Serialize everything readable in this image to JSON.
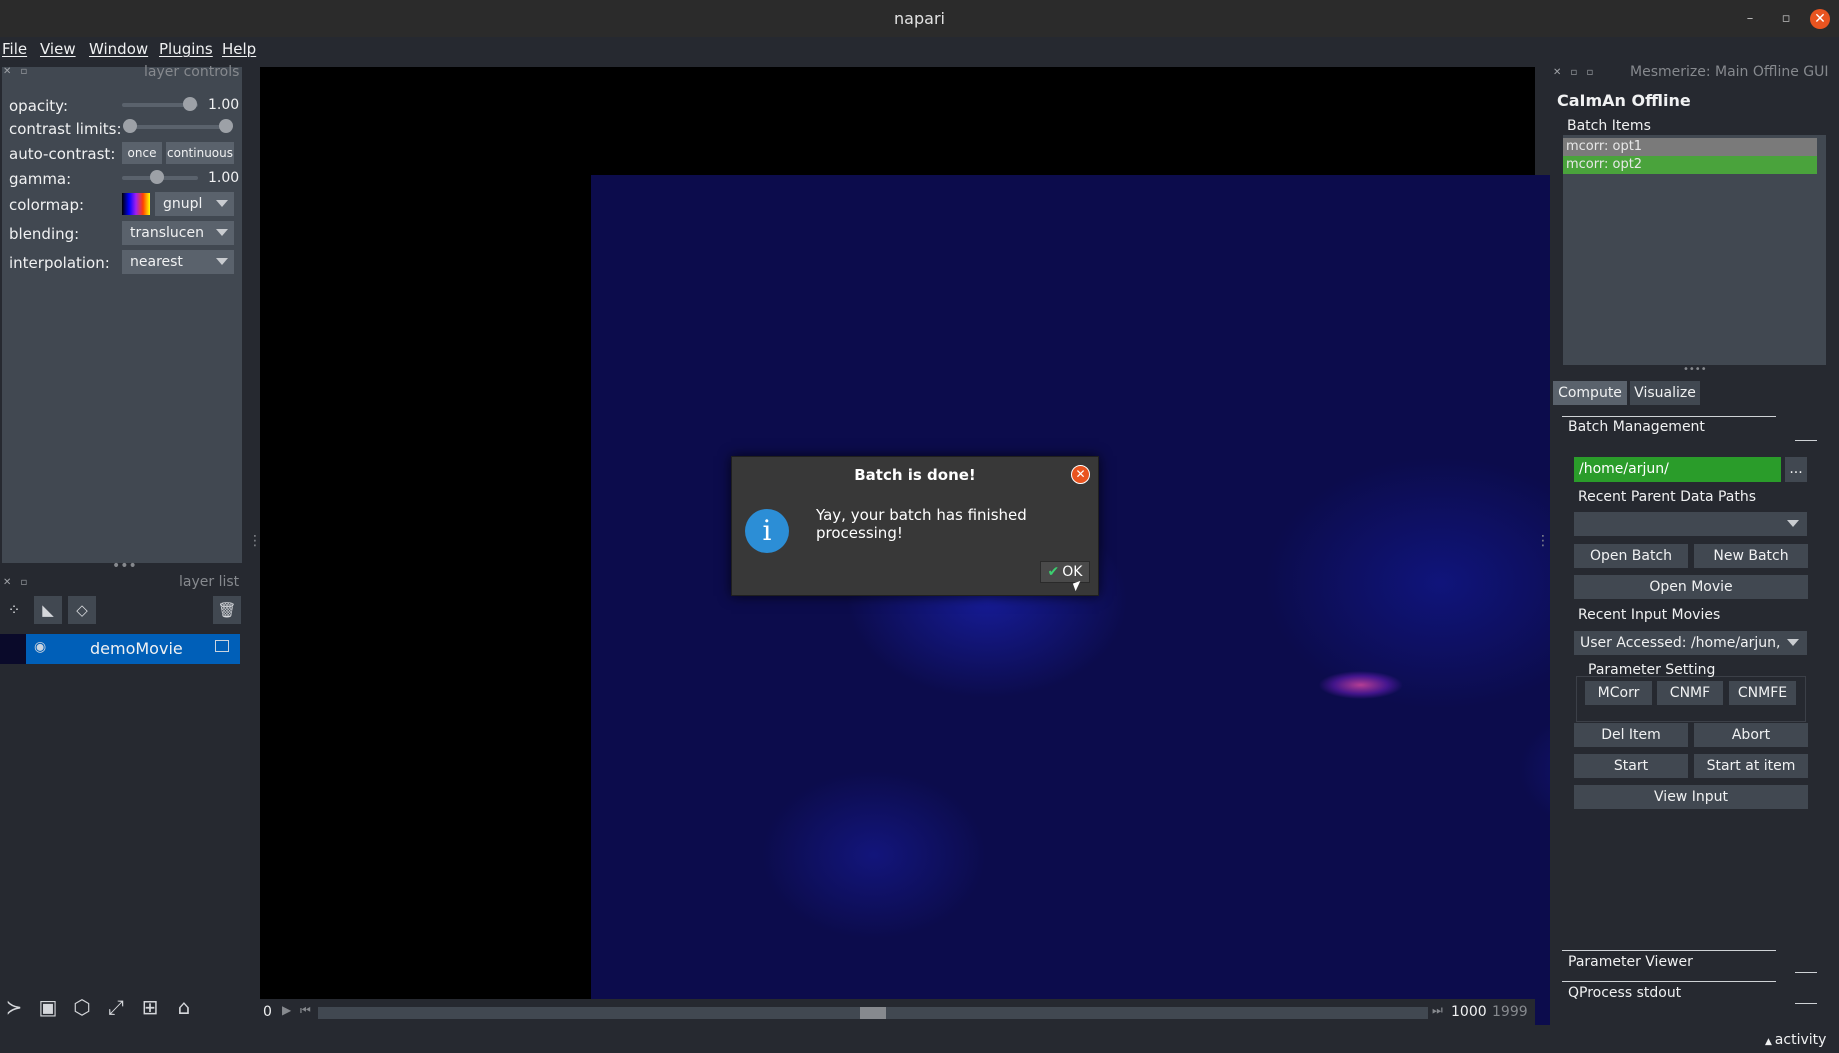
{
  "window": {
    "title": "napari",
    "close_icon": "✕",
    "minimize_icon": "–",
    "maximize_icon": "▫"
  },
  "menubar": [
    "File",
    "View",
    "Window",
    "Plugins",
    "Help"
  ],
  "layer_controls": {
    "header": "layer controls",
    "opacity_label": "opacity:",
    "opacity_value": "1.00",
    "contrast_label": "contrast limits:",
    "autocontrast_label": "auto-contrast:",
    "autocontrast_once": "once",
    "autocontrast_continuous": "continuous",
    "gamma_label": "gamma:",
    "gamma_value": "1.00",
    "colormap_label": "colormap:",
    "colormap_value": "gnupl",
    "blending_label": "blending:",
    "blending_value": "translucen",
    "interpolation_label": "interpolation:",
    "interpolation_value": "nearest"
  },
  "layer_list": {
    "header": "layer list",
    "layers": [
      {
        "name": "demoMovie",
        "visible": true
      }
    ]
  },
  "dims": {
    "current": "0",
    "value": "1000",
    "max": "1999"
  },
  "dialog": {
    "title": "Batch is done!",
    "message": "Yay, your batch has finished processing!",
    "ok_label": "OK"
  },
  "right_dock": {
    "window_title": "Mesmerize: Main Offline GUI",
    "app_title": "CaImAn Offline",
    "batch_items_label": "Batch Items",
    "batch_items": [
      {
        "label": "mcorr: opt1",
        "color": "#7a7a7a"
      },
      {
        "label": "mcorr: opt2",
        "color": "#4aa33c"
      }
    ],
    "tabs": [
      "Compute",
      "Visualize"
    ],
    "batch_management_label": "Batch Management",
    "parent_path": "/home/arjun/",
    "browse_label": "...",
    "recent_parent_label": "Recent Parent Data Paths",
    "recent_parent_value": "",
    "open_batch": "Open Batch",
    "new_batch": "New Batch",
    "open_movie": "Open Movie",
    "recent_input_label": "Recent Input Movies",
    "recent_input_value": "User Accessed: /home/arjun,",
    "parameter_setting_label": "Parameter Setting",
    "mcorr": "MCorr",
    "cnmf": "CNMF",
    "cnmfe": "CNMFE",
    "del_item": "Del Item",
    "abort": "Abort",
    "start": "Start",
    "start_at_item": "Start at item",
    "view_input": "View Input",
    "parameter_viewer_label": "Parameter Viewer",
    "qprocess_label": "QProcess stdout"
  },
  "status": {
    "activity": "activity"
  }
}
